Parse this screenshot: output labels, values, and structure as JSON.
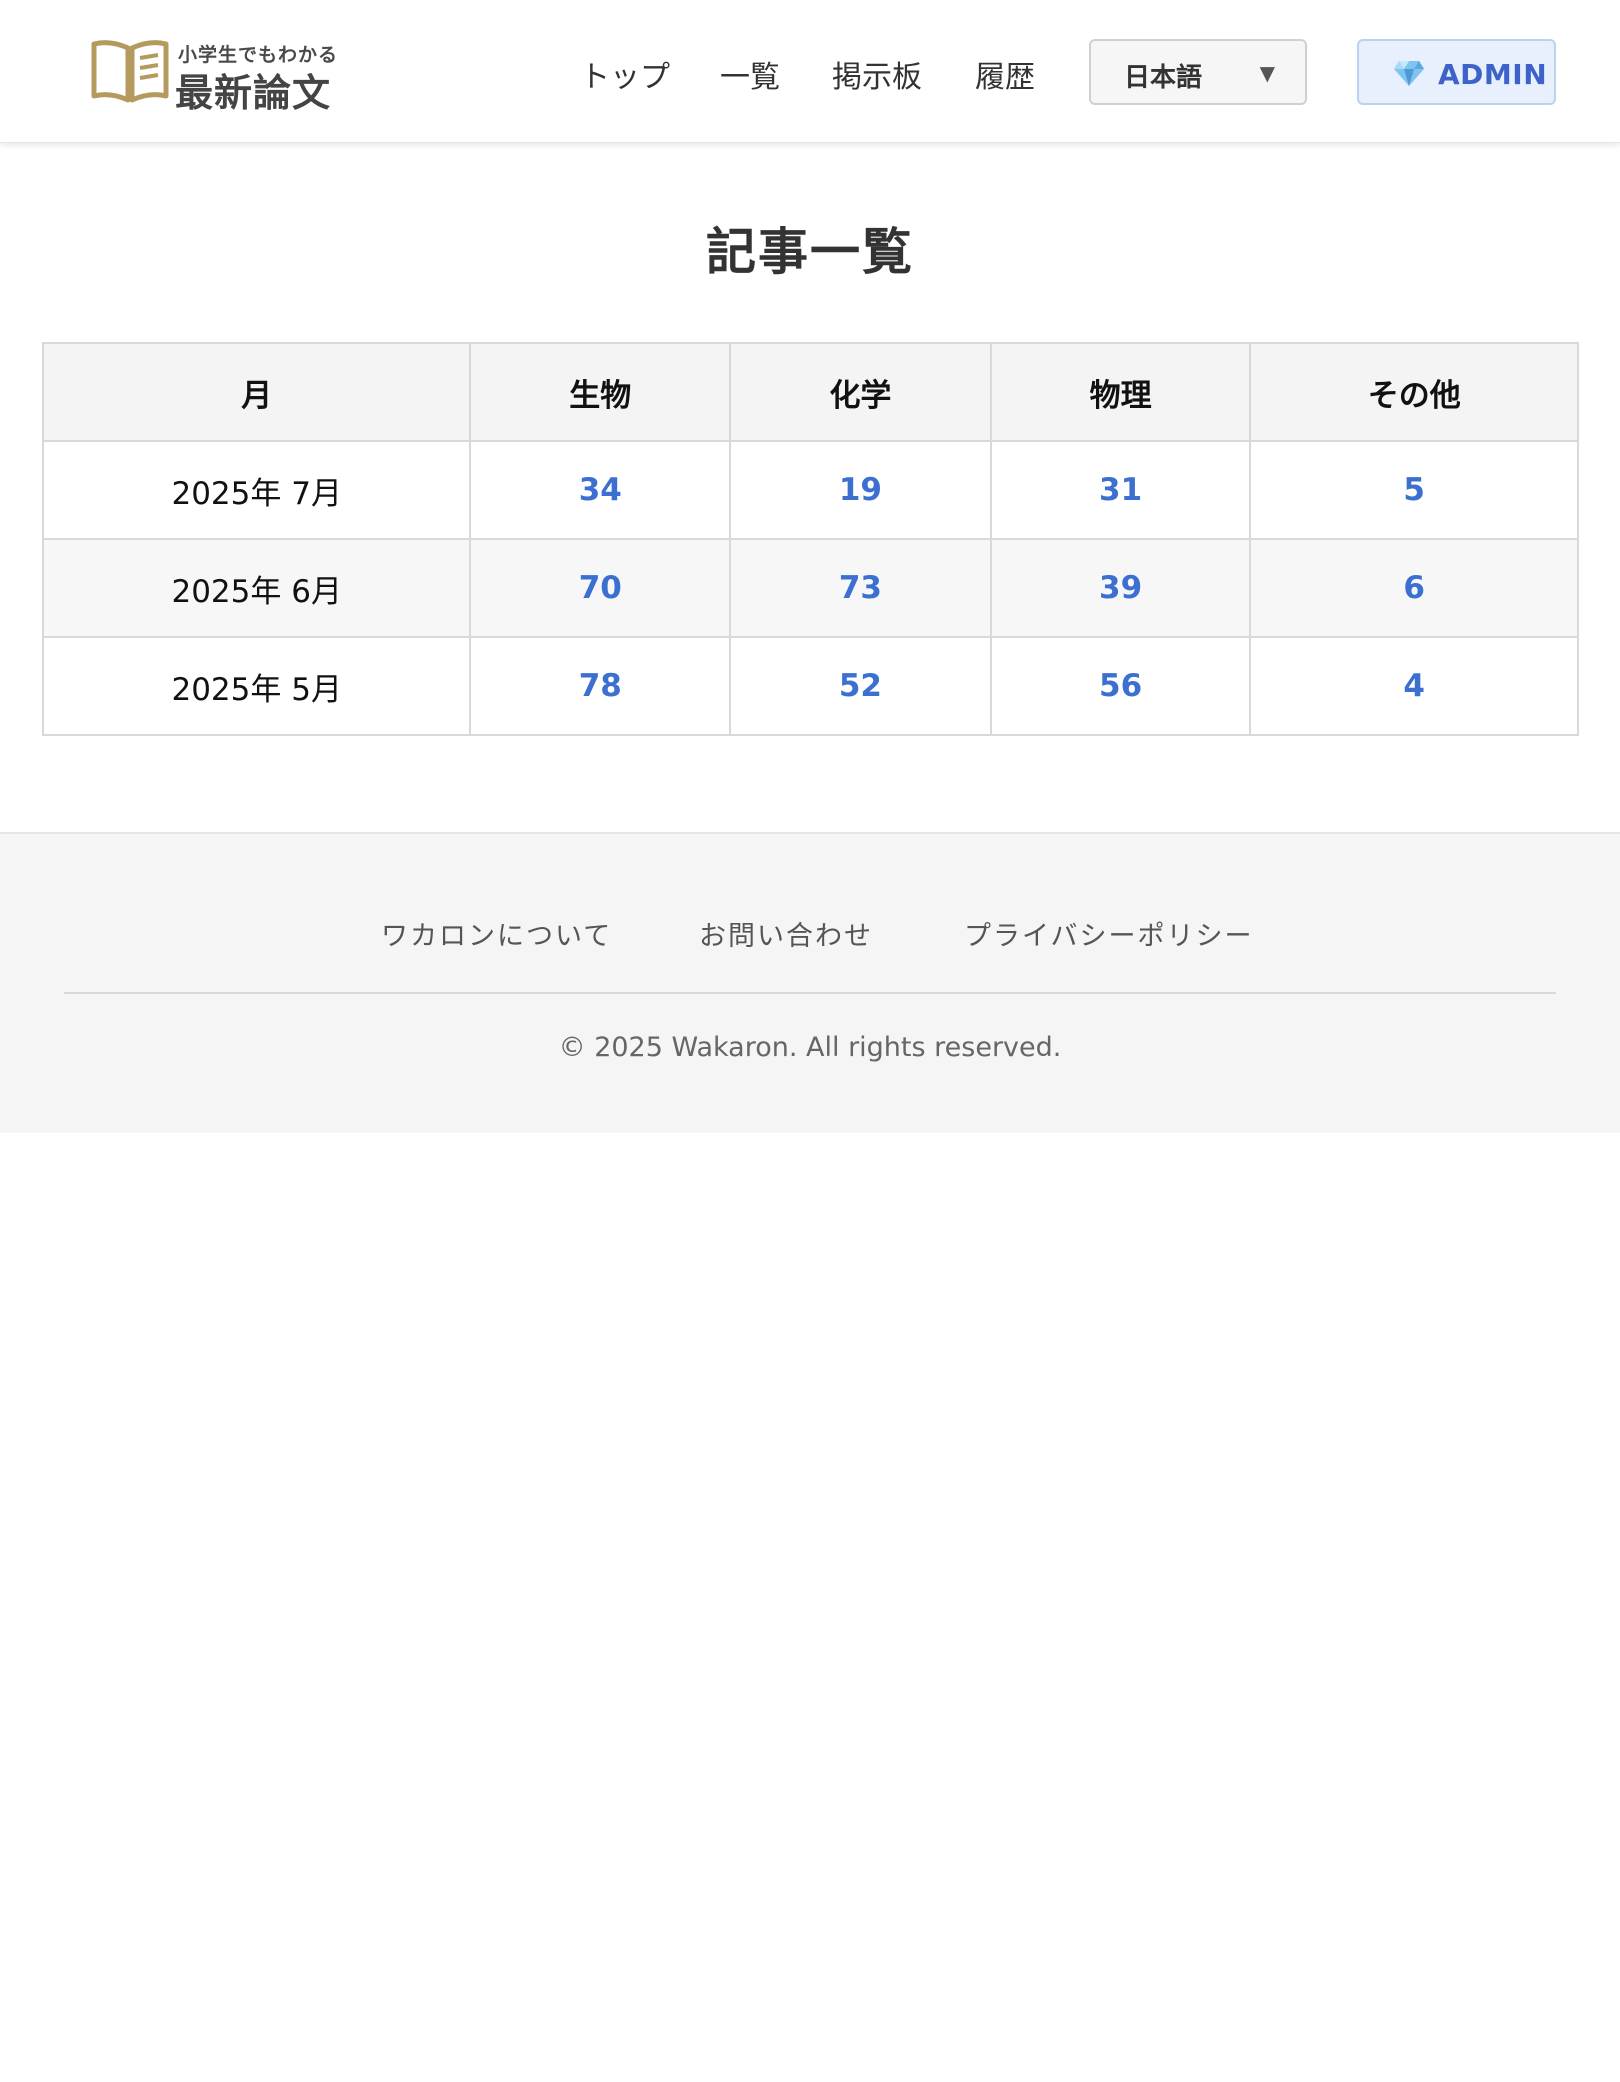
{
  "header": {
    "logo": {
      "subtitle": "小学生でもわかる",
      "title": "最新論文",
      "brand_color": "#b59a5e"
    },
    "nav": [
      {
        "label": "トップ"
      },
      {
        "label": "一覧"
      },
      {
        "label": "掲示板"
      },
      {
        "label": "履歴"
      }
    ],
    "language_select": {
      "selected": "日本語",
      "icon": "chevron-down-icon"
    },
    "admin_button": {
      "label": "ADMIN",
      "icon": "gem-icon",
      "accent_color": "#3d63c9"
    }
  },
  "main": {
    "title": "記事一覧",
    "table": {
      "headers": [
        "月",
        "生物",
        "化学",
        "物理",
        "その他"
      ],
      "rows": [
        {
          "month": "2025年 7月",
          "counts": [
            "34",
            "19",
            "31",
            "5"
          ]
        },
        {
          "month": "2025年 6月",
          "counts": [
            "70",
            "73",
            "39",
            "6"
          ]
        },
        {
          "month": "2025年 5月",
          "counts": [
            "78",
            "52",
            "56",
            "4"
          ]
        }
      ],
      "link_color": "#3b6fd0"
    }
  },
  "footer": {
    "links": [
      {
        "label": "ワカロンについて"
      },
      {
        "label": "お問い合わせ"
      },
      {
        "label": "プライバシーポリシー"
      }
    ],
    "copyright": "© 2025 Wakaron. All rights reserved."
  }
}
